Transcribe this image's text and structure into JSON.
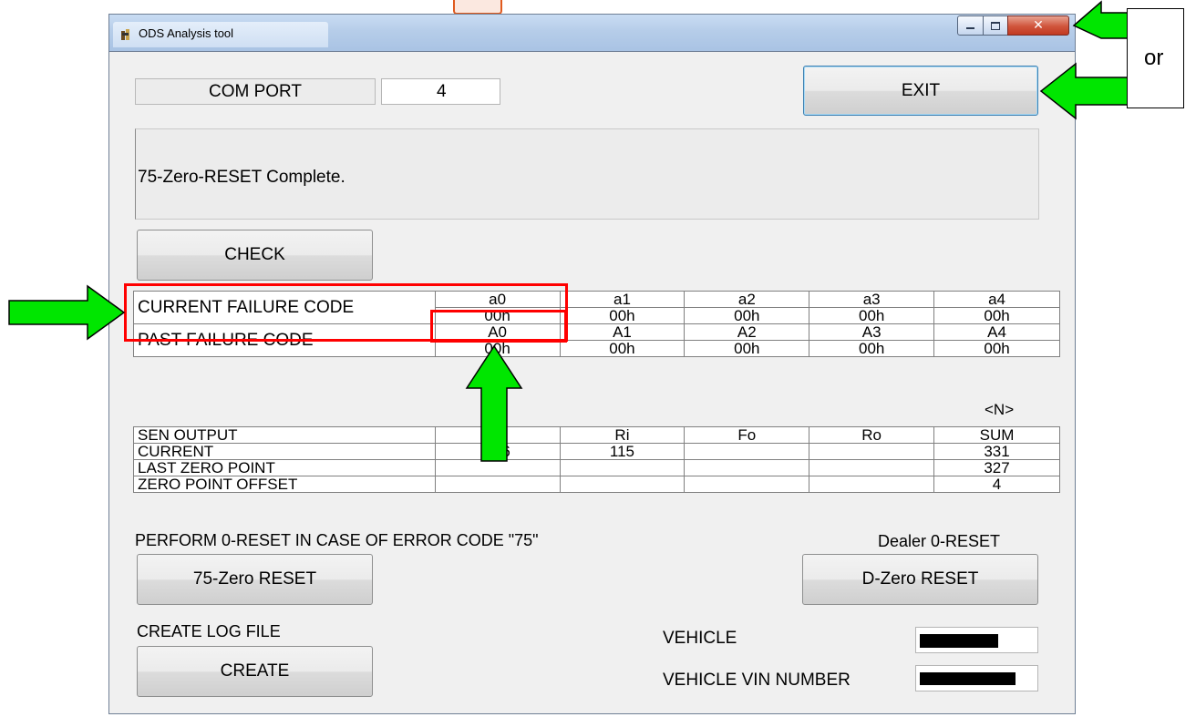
{
  "window": {
    "title": "ODS Analysis tool"
  },
  "com_port": {
    "label": "COM PORT",
    "value": "4"
  },
  "exit_label": "EXIT",
  "status_message": "75-Zero-RESET Complete.",
  "check_label": "CHECK",
  "failure_codes": {
    "current_label": "CURRENT FAILURE CODE",
    "past_label": "PAST FAILURE CODE",
    "current_headers": [
      "a0",
      "a1",
      "a2",
      "a3",
      "a4"
    ],
    "current_values": [
      "00h",
      "00h",
      "00h",
      "00h",
      "00h"
    ],
    "past_headers": [
      "A0",
      "A1",
      "A2",
      "A3",
      "A4"
    ],
    "past_values": [
      "00h",
      "00h",
      "00h",
      "00h",
      "00h"
    ]
  },
  "sensor": {
    "unit": "<N>",
    "headers": [
      "SEN OUTPUT",
      "",
      "Ri",
      "Fo",
      "Ro",
      "SUM"
    ],
    "rows": [
      [
        "CURRENT",
        "216",
        "115",
        "",
        "",
        "331"
      ],
      [
        "LAST ZERO POINT",
        "",
        "",
        "",
        "",
        "327"
      ],
      [
        "ZERO POINT OFFSET",
        "",
        "",
        "",
        "",
        "4"
      ]
    ]
  },
  "reset": {
    "instruction": "PERFORM 0-RESET IN CASE OF ERROR CODE \"75\"",
    "zero75_label": "75-Zero RESET",
    "dealer_label": "Dealer 0-RESET",
    "dzero_label": "D-Zero RESET"
  },
  "log": {
    "label": "CREATE LOG FILE",
    "create_label": "CREATE"
  },
  "vehicle": {
    "label": "VEHICLE",
    "vin_label": "VEHICLE VIN NUMBER"
  },
  "annotation": {
    "or_text": "or"
  },
  "colors": {
    "arrow": "#00e600",
    "highlight": "#ff0000",
    "title_bar": "#b6cde9"
  },
  "icons": [
    "app-icon",
    "minimize-icon",
    "maximize-icon",
    "close-icon",
    "arrow-right-icon",
    "arrow-left-icon",
    "arrow-up-icon"
  ]
}
